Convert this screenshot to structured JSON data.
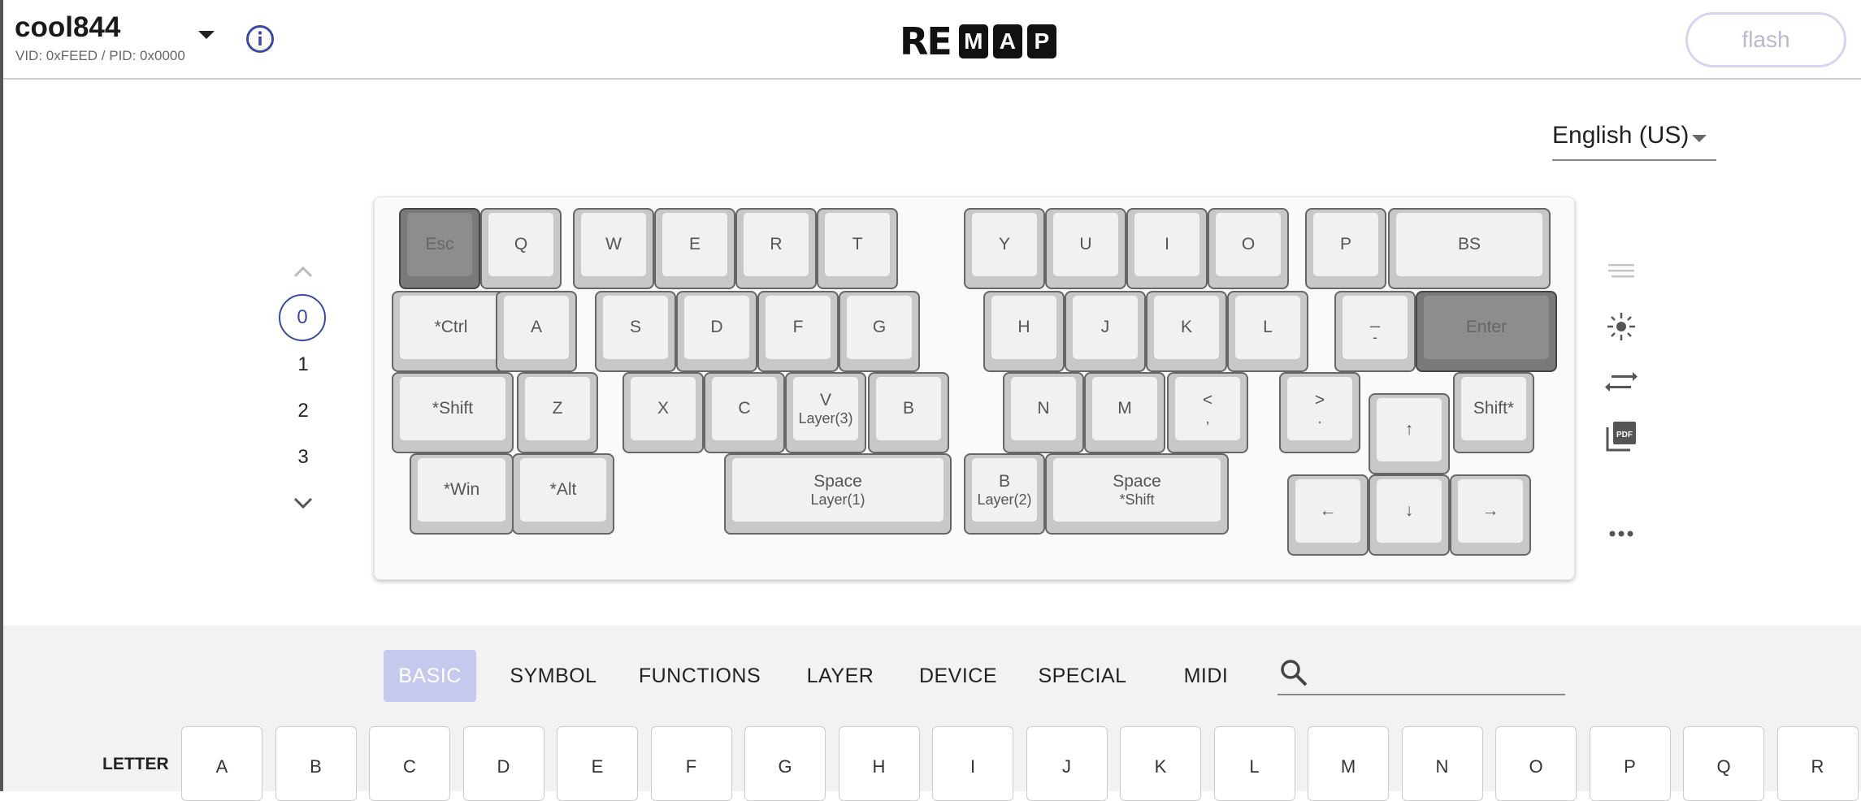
{
  "header": {
    "keyboard_name": "cool844",
    "vid_pid": "VID: 0xFEED / PID: 0x0000",
    "logo": {
      "prefix": "RE",
      "letters": [
        "M",
        "A",
        "P"
      ]
    },
    "flash_label": "flash"
  },
  "language": {
    "selected": "English (US)"
  },
  "layers": {
    "items": [
      "0",
      "1",
      "2",
      "3"
    ],
    "selected": "0"
  },
  "keyboard": {
    "keys": [
      {
        "l1": "Esc",
        "l2": ""
      },
      {
        "l1": "Q",
        "l2": ""
      },
      {
        "l1": "W",
        "l2": ""
      },
      {
        "l1": "E",
        "l2": ""
      },
      {
        "l1": "R",
        "l2": ""
      },
      {
        "l1": "T",
        "l2": ""
      },
      {
        "l1": "Y",
        "l2": ""
      },
      {
        "l1": "U",
        "l2": ""
      },
      {
        "l1": "I",
        "l2": ""
      },
      {
        "l1": "O",
        "l2": ""
      },
      {
        "l1": "P",
        "l2": ""
      },
      {
        "l1": "BS",
        "l2": ""
      },
      {
        "l1": "*Ctrl",
        "l2": ""
      },
      {
        "l1": "A",
        "l2": ""
      },
      {
        "l1": "S",
        "l2": ""
      },
      {
        "l1": "D",
        "l2": ""
      },
      {
        "l1": "F",
        "l2": ""
      },
      {
        "l1": "G",
        "l2": ""
      },
      {
        "l1": "H",
        "l2": ""
      },
      {
        "l1": "J",
        "l2": ""
      },
      {
        "l1": "K",
        "l2": ""
      },
      {
        "l1": "L",
        "l2": ""
      },
      {
        "l1": "_",
        "l2": "-"
      },
      {
        "l1": "Enter",
        "l2": ""
      },
      {
        "l1": "*Shift",
        "l2": ""
      },
      {
        "l1": "Z",
        "l2": ""
      },
      {
        "l1": "X",
        "l2": ""
      },
      {
        "l1": "C",
        "l2": ""
      },
      {
        "l1": "V",
        "l2": "Layer(3)"
      },
      {
        "l1": "B",
        "l2": ""
      },
      {
        "l1": "N",
        "l2": ""
      },
      {
        "l1": "M",
        "l2": ""
      },
      {
        "l1": "<",
        "l2": ","
      },
      {
        "l1": ">",
        "l2": "."
      },
      {
        "l1": "↑",
        "l2": ""
      },
      {
        "l1": "Shift*",
        "l2": ""
      },
      {
        "l1": "*Win",
        "l2": ""
      },
      {
        "l1": "*Alt",
        "l2": ""
      },
      {
        "l1": "Space",
        "l2": "Layer(1)"
      },
      {
        "l1": "B",
        "l2": "Layer(2)"
      },
      {
        "l1": "Space",
        "l2": "*Shift"
      },
      {
        "l1": "←",
        "l2": ""
      },
      {
        "l1": "↓",
        "l2": ""
      },
      {
        "l1": "→",
        "l2": ""
      }
    ]
  },
  "tools": [
    "menu-lines-icon",
    "light-icon",
    "swap-icon",
    "pdf-icon",
    "more-icon"
  ],
  "tabs": [
    {
      "label": "BASIC",
      "active": true
    },
    {
      "label": "SYMBOL"
    },
    {
      "label": "FUNCTIONS"
    },
    {
      "label": "LAYER"
    },
    {
      "label": "DEVICE"
    },
    {
      "label": "SPECIAL"
    },
    {
      "label": "MIDI"
    }
  ],
  "search": {
    "placeholder": ""
  },
  "letter_row": {
    "label": "LETTER",
    "keys": [
      "A",
      "B",
      "C",
      "D",
      "E",
      "F",
      "G",
      "H",
      "I",
      "J",
      "K",
      "L",
      "M",
      "N",
      "O",
      "P",
      "Q",
      "R"
    ]
  },
  "colors": {
    "accent": "#3a4aa0",
    "tab_active_bg": "#c5c9ee",
    "flash_border": "#d5d5ee"
  }
}
